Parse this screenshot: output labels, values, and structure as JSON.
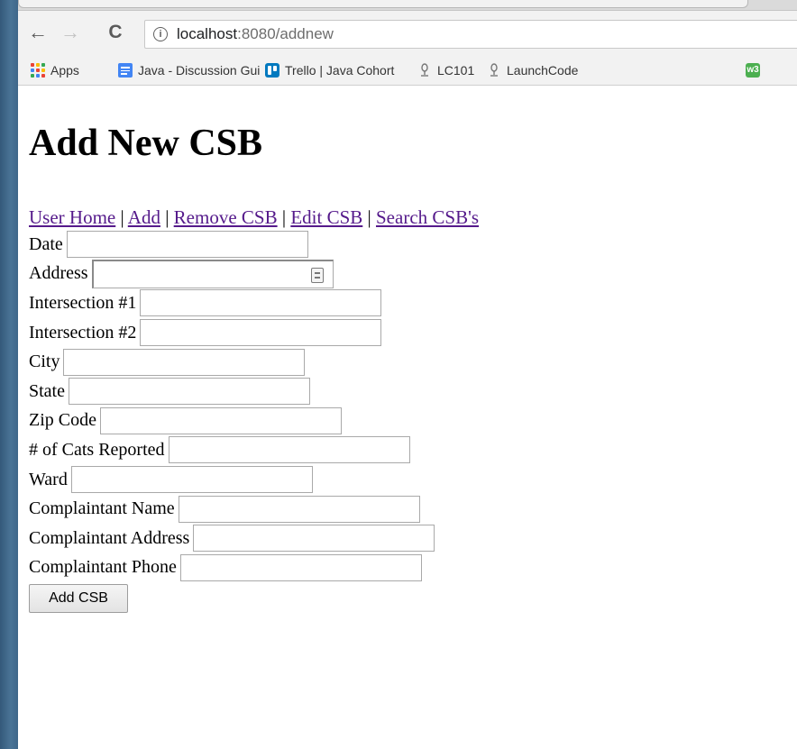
{
  "browser": {
    "url_host": "localhost",
    "url_rest": ":8080/addnew",
    "info_glyph": "i",
    "back_glyph": "←",
    "forward_glyph": "→",
    "reload_glyph": "C",
    "bookmarks": [
      {
        "label": "Apps",
        "icon": "apps-grid-icon"
      },
      {
        "label": "Java - Discussion Gui",
        "icon": "docs-icon"
      },
      {
        "label": "Trello | Java Cohort",
        "icon": "trello-icon"
      },
      {
        "label": "LC101",
        "icon": "launchcode-pin-icon"
      },
      {
        "label": "LaunchCode",
        "icon": "launchcode-pin-icon"
      },
      {
        "label": "",
        "icon": "w3schools-icon"
      }
    ],
    "w3_glyph": "w3"
  },
  "page": {
    "title": "Add New CSB",
    "nav": {
      "home": "User Home",
      "add": "Add",
      "remove": "Remove CSB",
      "edit": "Edit CSB",
      "search": "Search CSB's",
      "separator": " | "
    },
    "form": {
      "fields": [
        {
          "label": "Date",
          "value": ""
        },
        {
          "label": "Address",
          "value": ""
        },
        {
          "label": "Intersection #1",
          "value": ""
        },
        {
          "label": "Intersection #2",
          "value": ""
        },
        {
          "label": "City",
          "value": ""
        },
        {
          "label": "State",
          "value": ""
        },
        {
          "label": "Zip Code",
          "value": ""
        },
        {
          "label": "# of Cats Reported",
          "value": ""
        },
        {
          "label": "Ward",
          "value": ""
        },
        {
          "label": "Complaintant Name",
          "value": ""
        },
        {
          "label": "Complaintant Address",
          "value": ""
        },
        {
          "label": "Complaintant Phone",
          "value": ""
        }
      ],
      "submit_label": "Add CSB"
    }
  },
  "colors": {
    "link": "#551a8b",
    "desktop": "#3b6182",
    "chrome": "#f2f2f2"
  }
}
